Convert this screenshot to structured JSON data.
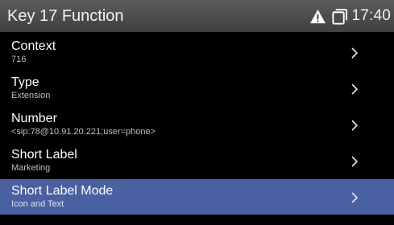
{
  "header": {
    "title": "Key 17 Function",
    "time": "17:40",
    "icons": [
      "warning-icon",
      "copy-icon"
    ]
  },
  "rows": [
    {
      "label": "Context",
      "value": "716"
    },
    {
      "label": "Type",
      "value": "Extension"
    },
    {
      "label": "Number",
      "value": "<sip:78@10.91.20.221;user=phone>"
    },
    {
      "label": "Short Label",
      "value": "Marketing"
    },
    {
      "label": "Short Label Mode",
      "value": "Icon and Text"
    }
  ],
  "selected_row_label": "Short Label Mode",
  "colors": {
    "header_top": "#5c5c5c",
    "header_bottom": "#3f3f3f",
    "background": "#000000",
    "selection": "#4b5fa3",
    "secondary_text": "#bfbfbf"
  }
}
